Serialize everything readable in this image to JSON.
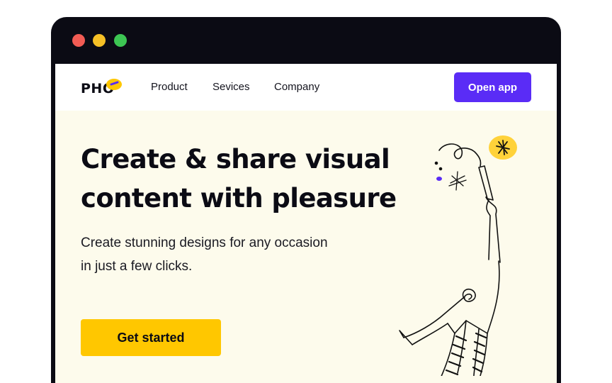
{
  "window": {
    "controls": [
      "close",
      "minimize",
      "maximize"
    ]
  },
  "nav": {
    "logo_text": "PHO",
    "links": [
      "Product",
      "Sevices",
      "Company"
    ],
    "open_app_label": "Open app"
  },
  "hero": {
    "headline_line1": "Create & share visual",
    "headline_line2": "content with pleasure",
    "subtext_line1": "Create stunning designs for any occasion",
    "subtext_line2": "in just a few clicks.",
    "cta_label": "Get started"
  },
  "colors": {
    "primary": "#5a2cf6",
    "accent": "#ffc700",
    "background": "#fdfbec",
    "frame": "#0b0b14"
  },
  "icons": [
    "close-dot-icon",
    "minimize-dot-icon",
    "maximize-dot-icon",
    "logo-blob-icon",
    "floating-person-illustration"
  ]
}
